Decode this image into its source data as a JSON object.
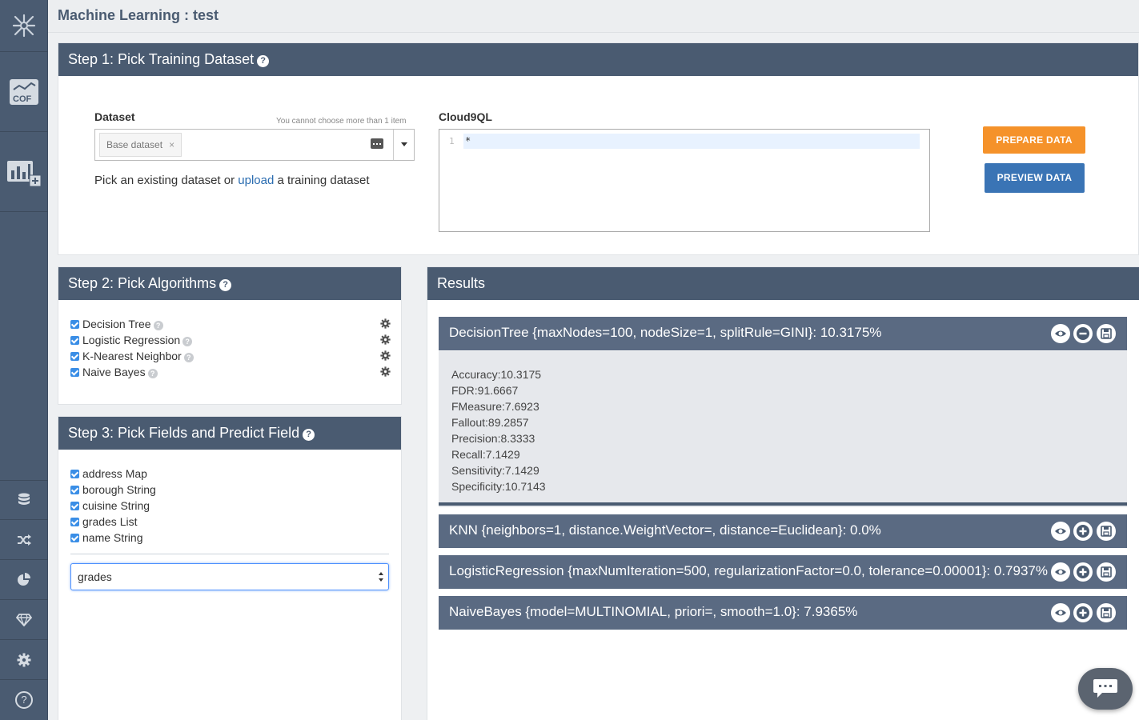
{
  "page": {
    "title": "Machine Learning : test"
  },
  "sidebar": {
    "items": [
      {
        "name": "logo-icon"
      },
      {
        "name": "machine-learning-icon"
      },
      {
        "name": "add-chart-icon"
      },
      {
        "name": "database-icon"
      },
      {
        "name": "shuffle-icon"
      },
      {
        "name": "pie-chart-icon"
      },
      {
        "name": "diamond-icon"
      },
      {
        "name": "settings-icon"
      },
      {
        "name": "help-icon",
        "label": "?"
      }
    ]
  },
  "step1": {
    "title": "Step 1: Pick Training Dataset",
    "dataset_label": "Dataset",
    "limit_hint": "You cannot choose more than 1 item",
    "selected_tag": "Base dataset",
    "tag_remove": "×",
    "helper_before": "Pick an existing dataset or",
    "helper_link": "upload",
    "helper_after": "a training dataset",
    "query_label": "Cloud9QL",
    "editor_line_number": "1",
    "editor_text": "*",
    "prepare_button": "PREPARE DATA",
    "preview_button": "PREVIEW DATA"
  },
  "step2": {
    "title": "Step 2: Pick Algorithms",
    "algorithms": [
      {
        "label": "Decision Tree",
        "checked": true
      },
      {
        "label": "Logistic Regression",
        "checked": true
      },
      {
        "label": "K-Nearest Neighbor",
        "checked": true
      },
      {
        "label": "Naive Bayes",
        "checked": true
      }
    ]
  },
  "step3": {
    "title": "Step 3: Pick Fields and Predict Field",
    "fields": [
      {
        "label": "address Map",
        "checked": true
      },
      {
        "label": "borough String",
        "checked": true
      },
      {
        "label": "cuisine String",
        "checked": true
      },
      {
        "label": "grades List",
        "checked": true
      },
      {
        "label": "name String",
        "checked": true
      }
    ],
    "predict_field": "grades"
  },
  "results": {
    "title": "Results",
    "items": [
      {
        "title": "DecisionTree {maxNodes=100, nodeSize=1, splitRule=GINI}: 10.3175%",
        "expanded": true,
        "metrics": [
          "Accuracy:10.3175",
          "FDR:91.6667",
          "FMeasure:7.6923",
          "Fallout:89.2857",
          "Precision:8.3333",
          "Recall:7.1429",
          "Sensitivity:7.1429",
          "Specificity:10.7143"
        ]
      },
      {
        "title": "KNN {neighbors=1, distance.WeightVector=, distance=Euclidean}: 0.0%",
        "expanded": false
      },
      {
        "title": "LogisticRegression {maxNumIteration=500, regularizationFactor=0.0, tolerance=0.00001}: 0.7937%",
        "expanded": false
      },
      {
        "title": "NaiveBayes {model=MULTINOMIAL, priori=, smooth=1.0}: 7.9365%",
        "expanded": false
      }
    ]
  },
  "colors": {
    "sidebar": "#4a5b71",
    "panel_header": "#4a5b71",
    "result_bar": "#5a6a82",
    "accent_orange": "#f5922a",
    "accent_blue": "#3a74b5",
    "checkbox": "#3a8ee6"
  }
}
